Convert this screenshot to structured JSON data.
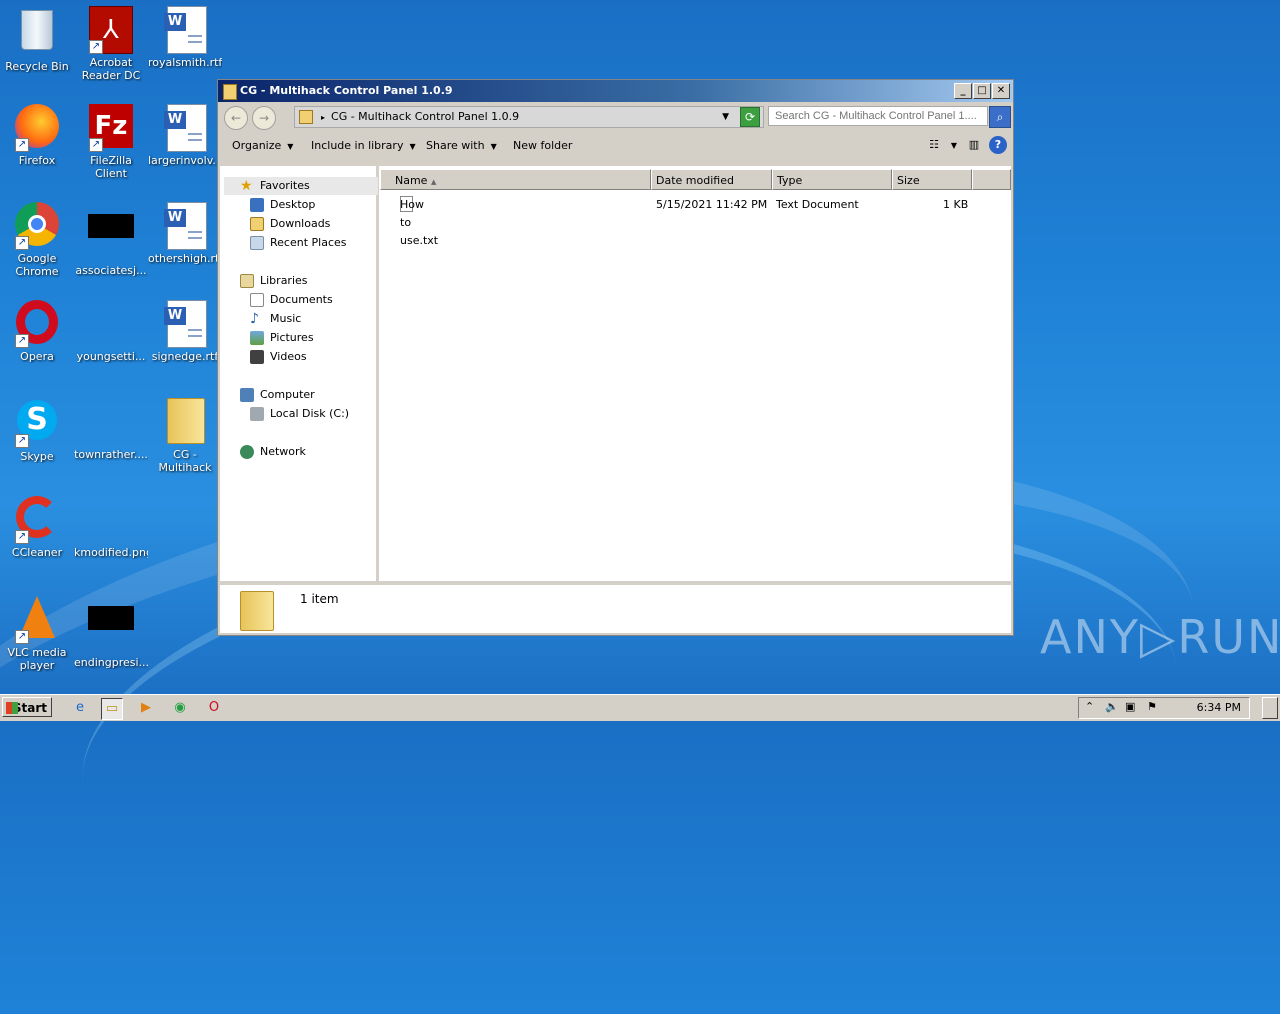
{
  "desktop": {
    "icons": [
      {
        "label": "Recycle Bin",
        "name": "recycle-bin-icon"
      },
      {
        "label": "Acrobat Reader DC",
        "name": "acrobat-icon"
      },
      {
        "label": "royalsmith.rtf",
        "name": "rtf-document-icon"
      },
      {
        "label": "Firefox",
        "name": "firefox-icon"
      },
      {
        "label": "FileZilla Client",
        "name": "filezilla-icon"
      },
      {
        "label": "largerinvolv...",
        "name": "rtf-document-icon"
      },
      {
        "label": "Google Chrome",
        "name": "chrome-icon"
      },
      {
        "label": "associatesj...",
        "name": "black-file-icon"
      },
      {
        "label": "othershigh.rtf",
        "name": "rtf-document-icon"
      },
      {
        "label": "Opera",
        "name": "opera-icon"
      },
      {
        "label": "youngsetti...",
        "name": "blank-file-icon"
      },
      {
        "label": "signedge.rtf",
        "name": "rtf-document-icon"
      },
      {
        "label": "Skype",
        "name": "skype-icon"
      },
      {
        "label": "townrather....",
        "name": "blank-file-icon"
      },
      {
        "label": "CG - Multihack Control Pan...",
        "name": "folder-icon"
      },
      {
        "label": "CCleaner",
        "name": "ccleaner-icon"
      },
      {
        "label": "kmodified.png",
        "name": "png-file-icon"
      },
      {
        "label": "VLC media player",
        "name": "vlc-icon"
      },
      {
        "label": "endingpresi...",
        "name": "black-file-icon"
      }
    ]
  },
  "window": {
    "title": "CG - Multihack Control Panel 1.0.9",
    "address": "CG - Multihack Control Panel 1.0.9",
    "search_placeholder": "Search CG - Multihack Control Panel 1....",
    "toolbar": {
      "organize": "Organize",
      "include": "Include in library",
      "share": "Share with",
      "new_folder": "New folder"
    },
    "nav": {
      "favorites": "Favorites",
      "desktop": "Desktop",
      "downloads": "Downloads",
      "recent": "Recent Places",
      "libraries": "Libraries",
      "documents": "Documents",
      "music": "Music",
      "pictures": "Pictures",
      "videos": "Videos",
      "computer": "Computer",
      "local_disk": "Local Disk (C:)",
      "network": "Network"
    },
    "columns": {
      "name": "Name",
      "date": "Date modified",
      "type": "Type",
      "size": "Size"
    },
    "files": [
      {
        "name": "How to use.txt",
        "date": "5/15/2021 11:42 PM",
        "type": "Text Document",
        "size": "1 KB"
      }
    ],
    "status": "1 item"
  },
  "taskbar": {
    "start": "Start",
    "clock": "6:34 PM"
  },
  "watermark": "ANY▷RUN"
}
